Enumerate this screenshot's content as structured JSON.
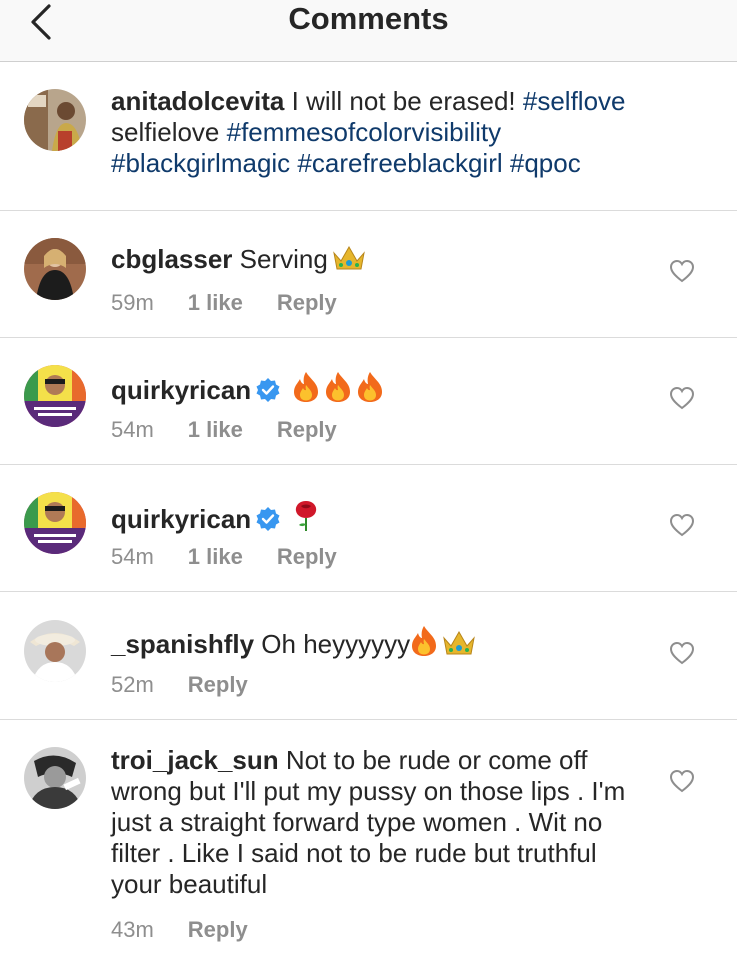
{
  "header": {
    "title": "Comments",
    "back_icon": "chevron-left-icon"
  },
  "post": {
    "username": "anitadolcevita",
    "text": " I will not be erased! ",
    "tag1": "#selflove",
    "text2": " selfielove ",
    "tag2": "#femmesofcolorvisibility",
    "tag3": "#blackgirlmagic",
    "tag4": "#carefreeblackgirl",
    "tag5": "#qpoc"
  },
  "comments": [
    {
      "username": "cbglasser",
      "text": " Serving",
      "emoji": [
        "crown-icon"
      ],
      "time": "59m",
      "likes": "1 like",
      "reply": "Reply"
    },
    {
      "username": "quirkyrican",
      "verified": true,
      "text": "",
      "emoji": [
        "fire-icon",
        "fire-icon",
        "fire-icon"
      ],
      "time": "54m",
      "likes": "1 like",
      "reply": "Reply"
    },
    {
      "username": "quirkyrican",
      "verified": true,
      "text": "",
      "emoji": [
        "rose-icon"
      ],
      "time": "54m",
      "likes": "1 like",
      "reply": "Reply"
    },
    {
      "username": "_spanishfly",
      "text": " Oh heyyyyyy",
      "emoji": [
        "fire-icon",
        "crown-icon"
      ],
      "time": "52m",
      "reply": "Reply"
    },
    {
      "username": "troi_jack_sun",
      "text": " Not to be rude or come off wrong but I'll put my pussy on those lips . I'm just a straight forward type women . Wit no filter . Like I said not to be rude but truthful your beautiful",
      "time": "43m",
      "reply": "Reply"
    }
  ],
  "colors": {
    "hashtag": "#0f3a6b",
    "meta": "#8e8e8e",
    "verified": "#3897f0"
  }
}
